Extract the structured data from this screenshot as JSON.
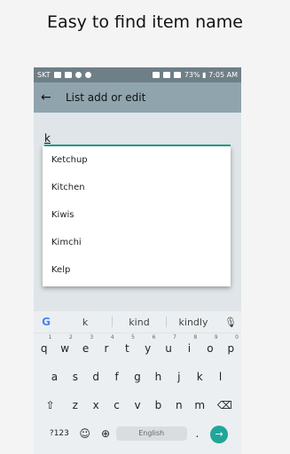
{
  "caption": "Easy to find item name",
  "status_bar": {
    "carrier": "SKT",
    "right_text": "73% ▮ 7:05 AM"
  },
  "app_bar": {
    "back_icon": "←",
    "title": "List add or edit"
  },
  "input": {
    "value": "k"
  },
  "suggestions": [
    "Ketchup",
    "Kitchen",
    "Kiwis",
    "Kimchi",
    "Kelp"
  ],
  "keyboard": {
    "google_icon": "G",
    "words": [
      "k",
      "kind",
      "kindly"
    ],
    "mic_icon": "🎙",
    "row1": [
      {
        "k": "q",
        "n": "1"
      },
      {
        "k": "w",
        "n": "2"
      },
      {
        "k": "e",
        "n": "3"
      },
      {
        "k": "r",
        "n": "4"
      },
      {
        "k": "t",
        "n": "5"
      },
      {
        "k": "y",
        "n": "6"
      },
      {
        "k": "u",
        "n": "7"
      },
      {
        "k": "i",
        "n": "8"
      },
      {
        "k": "o",
        "n": "9"
      },
      {
        "k": "p",
        "n": "0"
      }
    ],
    "row2": [
      "a",
      "s",
      "d",
      "f",
      "g",
      "h",
      "j",
      "k",
      "l"
    ],
    "row3": [
      "z",
      "x",
      "c",
      "v",
      "b",
      "n",
      "m"
    ],
    "shift": "⇧",
    "delete": "⌫",
    "symbols": "?123",
    "emoji": "☺",
    "globe": "⊕",
    "space_label": "English",
    "period": ".",
    "enter": "→"
  }
}
